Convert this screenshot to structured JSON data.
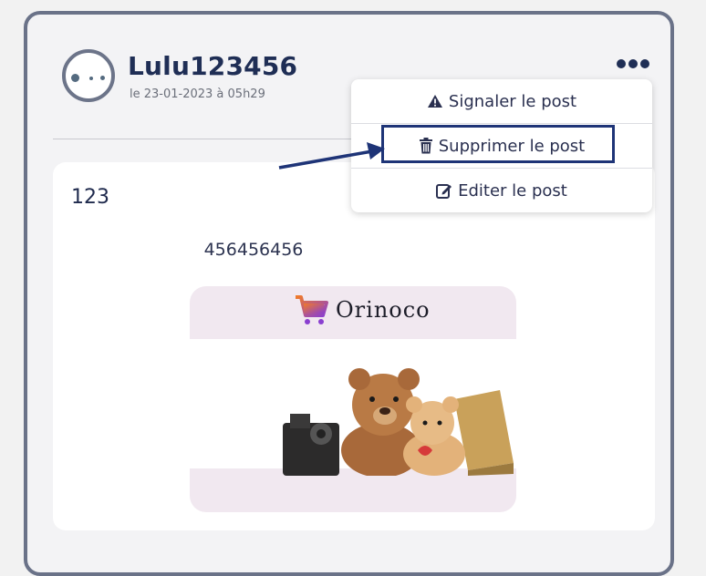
{
  "post": {
    "username": "Lulu123456",
    "date": "le 23-01-2023 à 05h29",
    "title": "123",
    "body": "456456456"
  },
  "image": {
    "logo_text": "Orinoco"
  },
  "menu": {
    "report_label": "Signaler le post",
    "delete_label": "Supprimer le post",
    "edit_label": "Editer le post"
  },
  "icons": {
    "more": "more-horizontal-icon",
    "report": "warning-icon",
    "delete": "trash-icon",
    "edit": "edit-icon",
    "cart": "cart-icon"
  },
  "colors": {
    "accent": "#1e3477",
    "text": "#1f2e55",
    "card_border": "#6a7288"
  }
}
